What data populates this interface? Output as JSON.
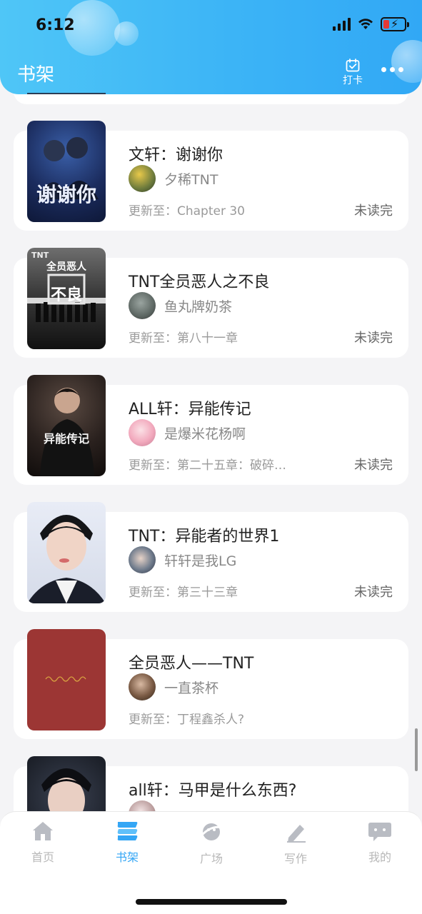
{
  "status_bar": {
    "time": "6:12"
  },
  "header": {
    "title": "书架",
    "checkin_label": "打卡"
  },
  "books": [
    {
      "title": "文轩：谢谢你",
      "author": "夕稀TNT",
      "update": "更新至：Chapter 30",
      "status": "未读完",
      "cover_text": "谢谢你"
    },
    {
      "title": "TNT全员恶人之不良",
      "author": "鱼丸牌奶茶",
      "update": "更新至：第八十一章",
      "status": "未读完",
      "cover_text": "不良",
      "cover_tag": "TNT",
      "cover_top": "全员恶人"
    },
    {
      "title": "ALL轩：异能传记",
      "author": "是爆米花杨啊",
      "update": "更新至：第二十五章：破碎…",
      "status": "未读完",
      "cover_text": "异能传记"
    },
    {
      "title": "TNT：异能者的世界1",
      "author": "轩轩是我LG",
      "update": "更新至：第三十三章",
      "status": "未读完"
    },
    {
      "title": "全员恶人——TNT",
      "author": "一直茶杯",
      "update": "更新至：丁程鑫杀人?",
      "status": ""
    },
    {
      "title": "all轩：马甲是什么东西?",
      "author": ""
    }
  ],
  "tabs": [
    {
      "label": "首页",
      "icon": "home-icon"
    },
    {
      "label": "书架",
      "icon": "bookshelf-icon"
    },
    {
      "label": "广场",
      "icon": "planet-icon"
    },
    {
      "label": "写作",
      "icon": "pen-icon"
    },
    {
      "label": "我的",
      "icon": "chat-bubble-icon"
    }
  ],
  "colors": {
    "accent": "#34a6f5",
    "header_gradient_start": "#4fc6f7",
    "header_gradient_end": "#31a8f5",
    "book5_cover": "#9c3634"
  }
}
